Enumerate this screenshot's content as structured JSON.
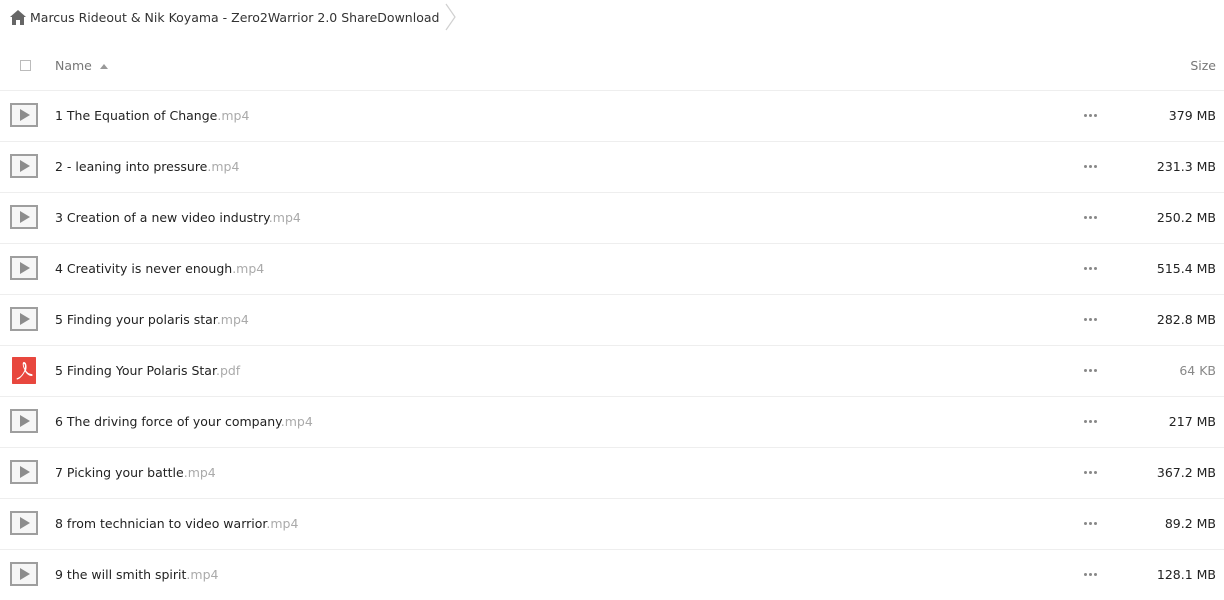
{
  "breadcrumb": {
    "home_icon": "home-icon",
    "folder_title": "Marcus Rideout & Nik Koyama - Zero2Warrior 2.0 ShareDownload"
  },
  "table": {
    "name_header": "Name",
    "size_header": "Size",
    "sort": "ascending"
  },
  "files": [
    {
      "name": "1 The Equation of Change",
      "ext": ".mp4",
      "size": "379 MB",
      "type": "video"
    },
    {
      "name": "2 - leaning into pressure",
      "ext": ".mp4",
      "size": "231.3 MB",
      "type": "video"
    },
    {
      "name": "3 Creation of a new video industry",
      "ext": ".mp4",
      "size": "250.2 MB",
      "type": "video"
    },
    {
      "name": "4 Creativity is never enough",
      "ext": ".mp4",
      "size": "515.4 MB",
      "type": "video"
    },
    {
      "name": "5 Finding your polaris star",
      "ext": ".mp4",
      "size": "282.8 MB",
      "type": "video"
    },
    {
      "name": "5 Finding Your Polaris Star",
      "ext": ".pdf",
      "size": "64 KB",
      "type": "pdf"
    },
    {
      "name": "6 The driving force of your company",
      "ext": ".mp4",
      "size": "217 MB",
      "type": "video"
    },
    {
      "name": "7 Picking your battle",
      "ext": ".mp4",
      "size": "367.2 MB",
      "type": "video"
    },
    {
      "name": "8 from technician to video warrior",
      "ext": ".mp4",
      "size": "89.2 MB",
      "type": "video"
    },
    {
      "name": "9 the will smith spirit",
      "ext": ".mp4",
      "size": "128.1 MB",
      "type": "video"
    }
  ],
  "colors": {
    "pdf_icon": "#e8473e",
    "video_icon": "#9e9e9e",
    "extension_text": "#aaaaaa"
  }
}
